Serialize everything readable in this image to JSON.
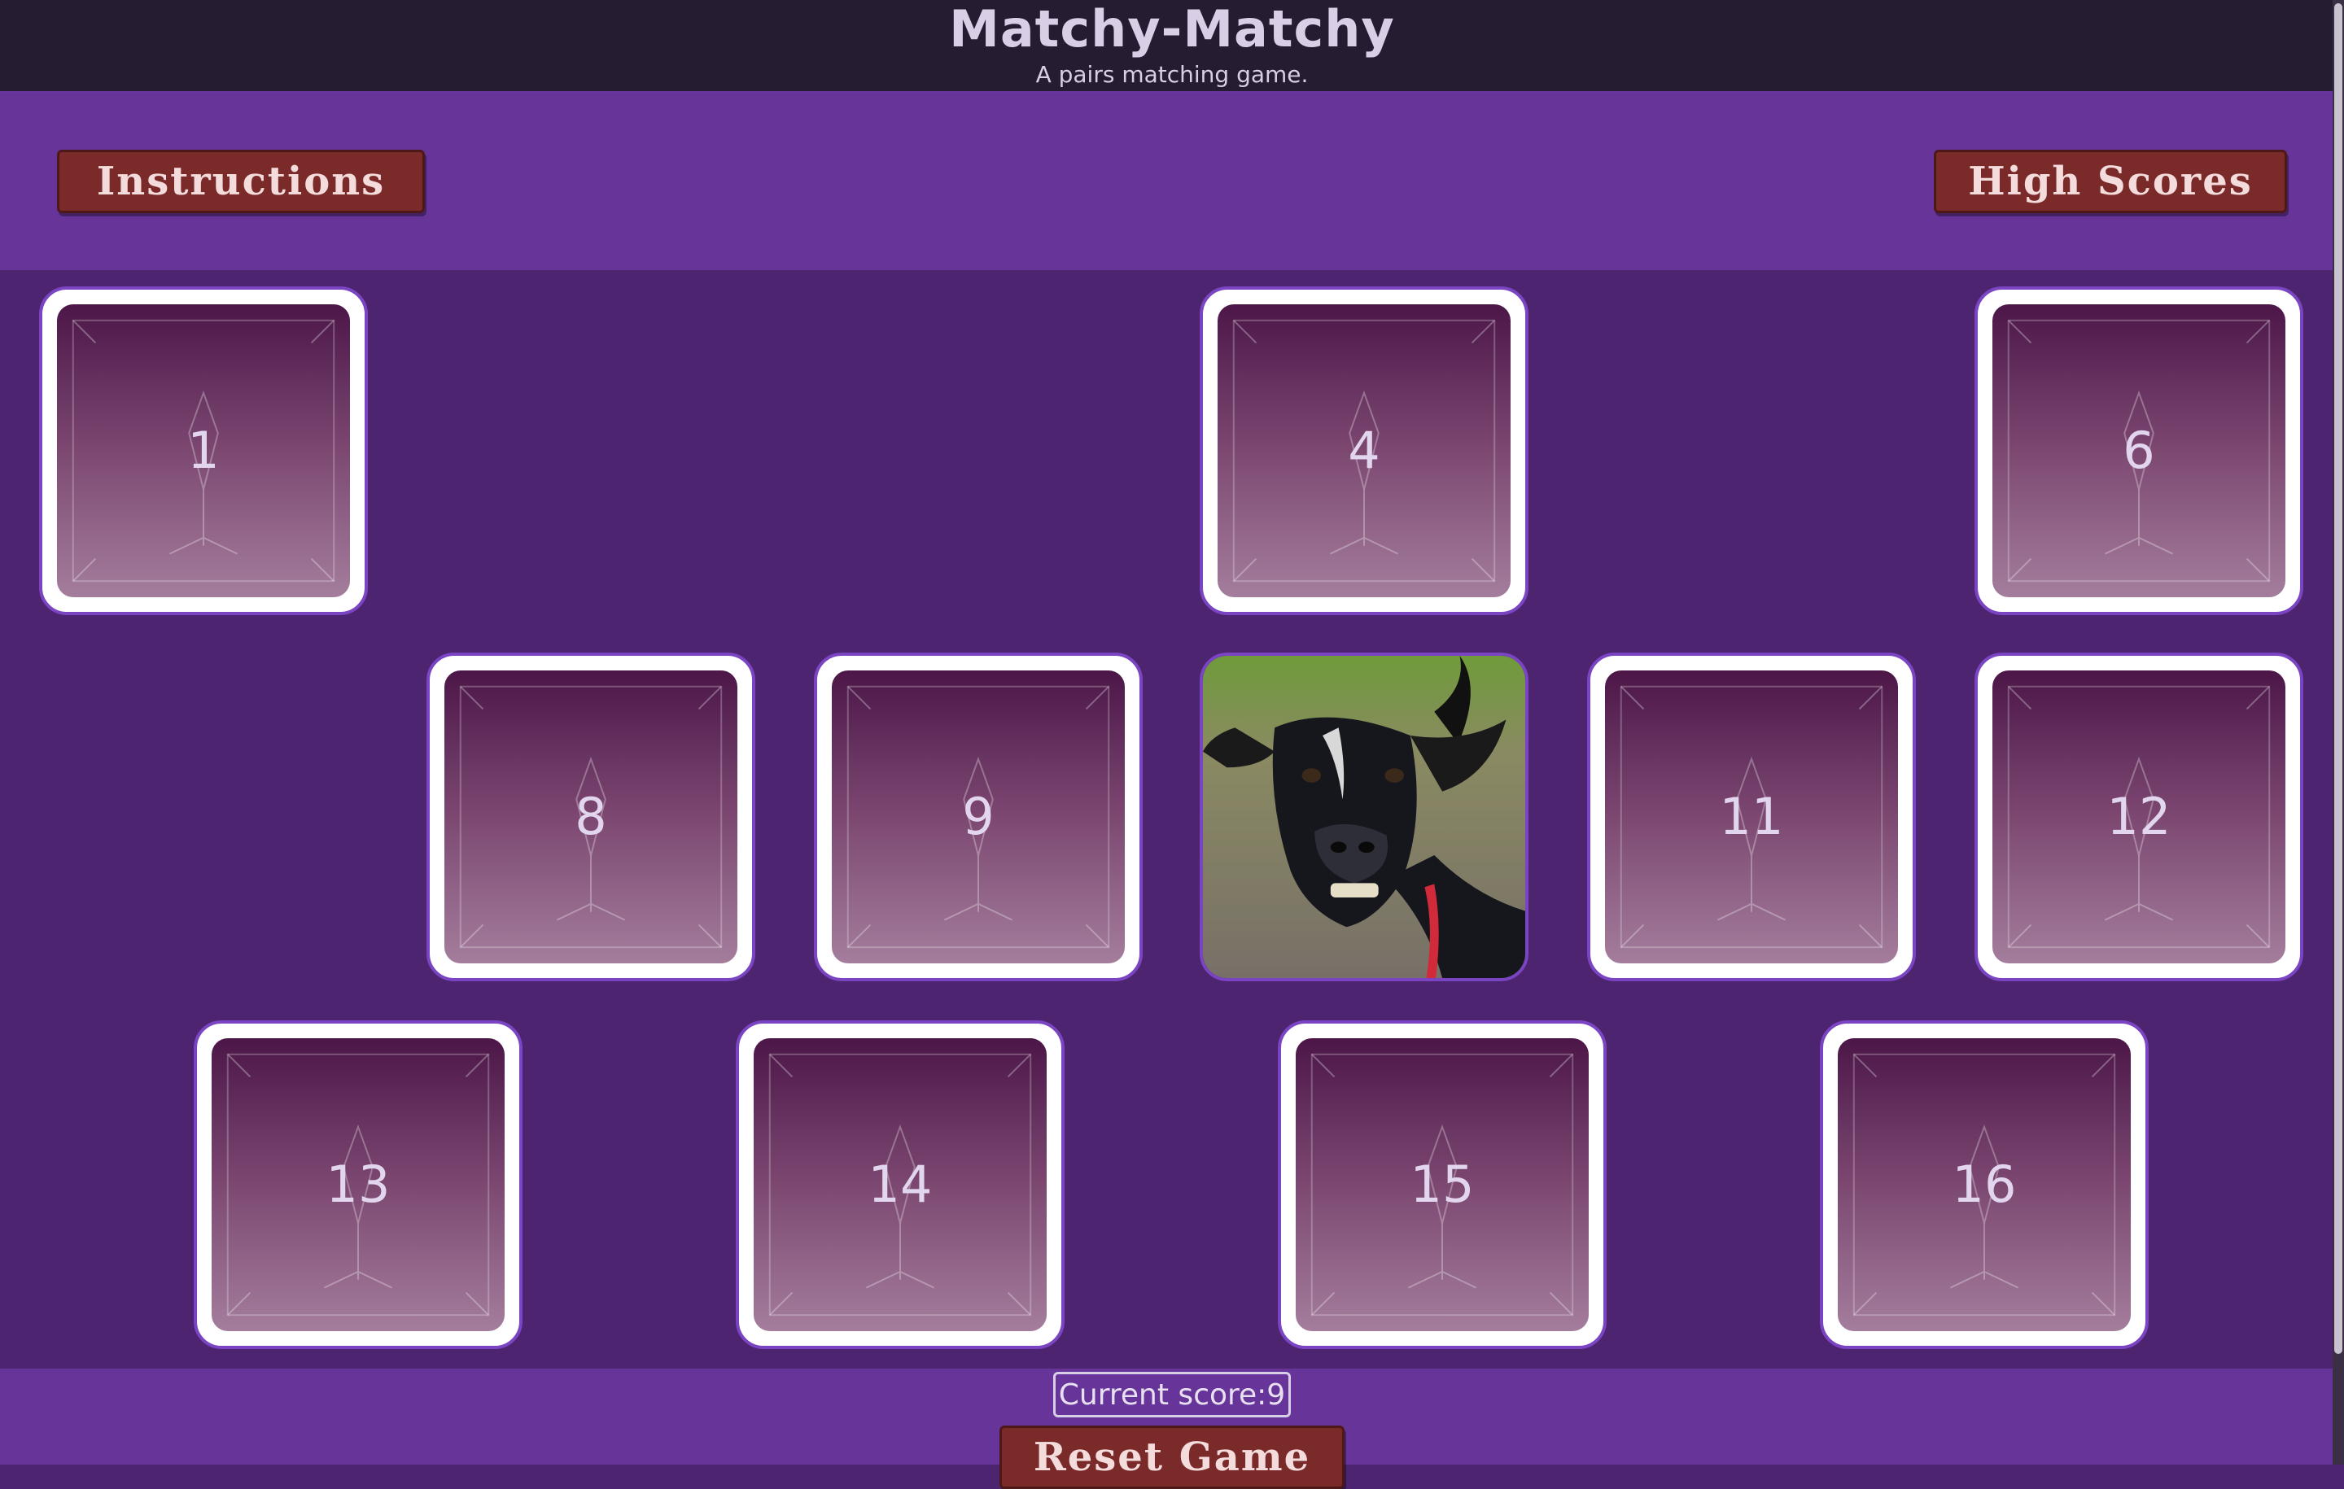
{
  "header": {
    "title": "Matchy-Matchy",
    "subtitle": "A pairs matching game."
  },
  "buttons": {
    "instructions": "Instructions",
    "high_scores": "High Scores",
    "reset": "Reset Game"
  },
  "score": {
    "label": "Current score:",
    "value": "9"
  },
  "cards": [
    {
      "label": "1",
      "state": "face-down"
    },
    {
      "label": "4",
      "state": "face-down"
    },
    {
      "label": "6",
      "state": "face-down"
    },
    {
      "label": "8",
      "state": "face-down"
    },
    {
      "label": "9",
      "state": "face-down"
    },
    {
      "label": "",
      "state": "face-up",
      "image": "goat-photo"
    },
    {
      "label": "11",
      "state": "face-down"
    },
    {
      "label": "12",
      "state": "face-down"
    },
    {
      "label": "13",
      "state": "face-down"
    },
    {
      "label": "14",
      "state": "face-down"
    },
    {
      "label": "15",
      "state": "face-down"
    },
    {
      "label": "16",
      "state": "face-down"
    }
  ],
  "colors": {
    "header_bg": "#261c31",
    "bar_bg": "#67359a",
    "board_bg": "#4c2470",
    "button_bg": "#7b2a2a",
    "card_border": "#7a44c2"
  }
}
